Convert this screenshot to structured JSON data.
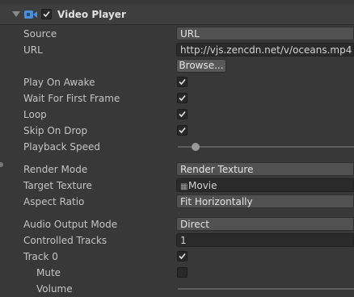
{
  "component": {
    "title": "Video Player",
    "enabled": true
  },
  "fields": {
    "source": {
      "label": "Source",
      "value": "URL"
    },
    "url": {
      "label": "URL",
      "value": "http://vjs.zencdn.net/v/oceans.mp4"
    },
    "browse": {
      "label": "Browse..."
    },
    "play_on_awake": {
      "label": "Play On Awake",
      "checked": true
    },
    "wait_first_frame": {
      "label": "Wait For First Frame",
      "checked": true
    },
    "loop": {
      "label": "Loop",
      "checked": true
    },
    "skip_on_drop": {
      "label": "Skip On Drop",
      "checked": true
    },
    "playback_speed": {
      "label": "Playback Speed",
      "value": 0.1
    },
    "render_mode": {
      "label": "Render Mode",
      "value": "Render Texture"
    },
    "target_texture": {
      "label": "Target Texture",
      "value": "Movie",
      "icon": "render-texture-icon"
    },
    "aspect_ratio": {
      "label": "Aspect Ratio",
      "value": "Fit Horizontally"
    },
    "audio_output_mode": {
      "label": "Audio Output Mode",
      "value": "Direct"
    },
    "controlled_tracks": {
      "label": "Controlled Tracks",
      "value": "1"
    },
    "track0": {
      "label": "Track 0",
      "checked": true
    },
    "mute": {
      "label": "Mute",
      "checked": false
    },
    "volume": {
      "label": "Volume"
    }
  },
  "colors": {
    "accent": "#4a8fd8",
    "panel": "#383838"
  }
}
